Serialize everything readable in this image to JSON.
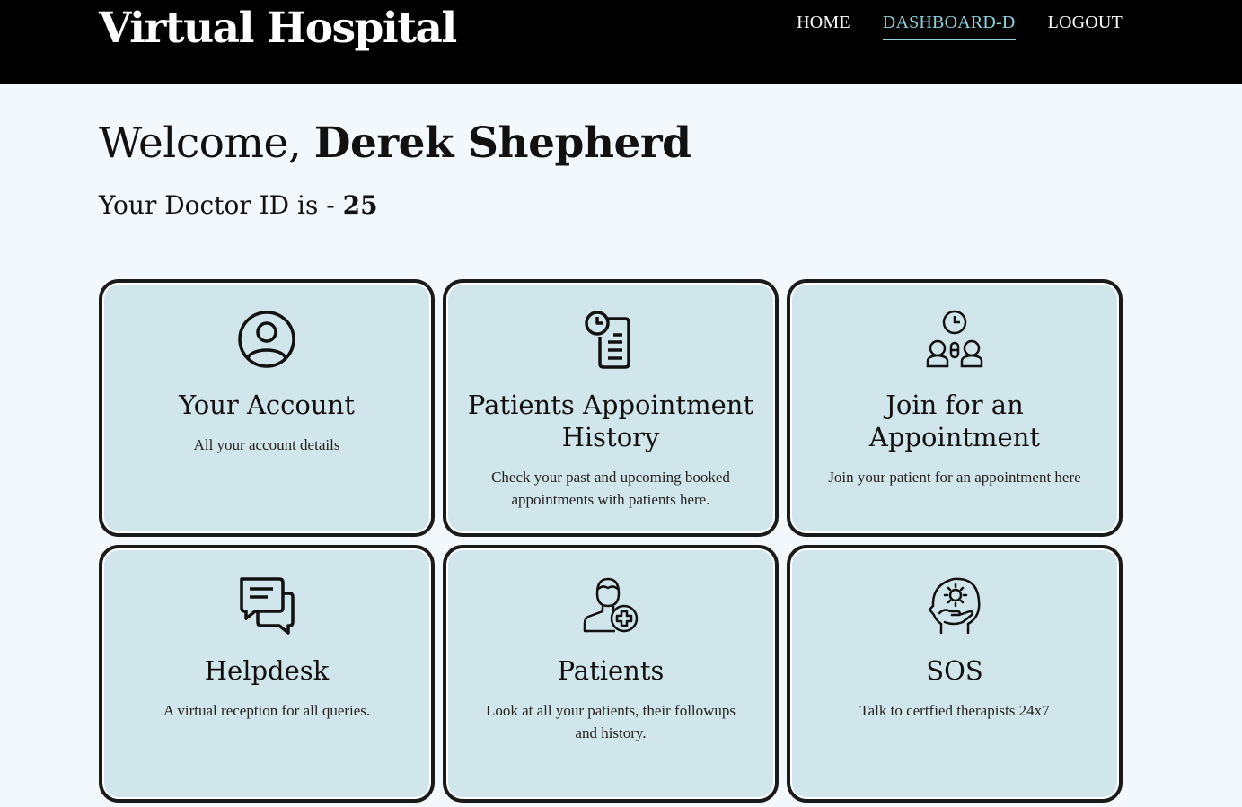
{
  "header": {
    "brand": "Virtual Hospital",
    "nav": [
      {
        "label": "HOME",
        "active": false
      },
      {
        "label": "DASHBOARD-D",
        "active": true
      },
      {
        "label": "LOGOUT",
        "active": false
      }
    ]
  },
  "welcome": {
    "greeting": "Welcome, ",
    "name": "Derek Shepherd",
    "id_prefix": "Your Doctor ID is - ",
    "doctor_id": "25"
  },
  "cards": [
    {
      "icon": "user-circle-icon",
      "title": "Your Account",
      "description": "All your account details"
    },
    {
      "icon": "clipboard-clock-icon",
      "title": "Patients Appointment History",
      "description": "Check your past and upcoming booked appointments with patients here."
    },
    {
      "icon": "meeting-clock-icon",
      "title": "Join for an Appointment",
      "description": "Join your patient for an appointment here"
    },
    {
      "icon": "chat-bubbles-icon",
      "title": "Helpdesk",
      "description": "A virtual reception for all queries."
    },
    {
      "icon": "patient-plus-icon",
      "title": "Patients",
      "description": "Look at all your patients, their followups and history."
    },
    {
      "icon": "mental-health-icon",
      "title": "SOS",
      "description": "Talk to certfied therapists 24x7"
    }
  ],
  "colors": {
    "header_bg": "#000000",
    "nav_active": "#8fd3e0",
    "page_bg": "#f2f8fb",
    "card_bg": "#d1e6ea",
    "card_border": "#1a1a1a"
  }
}
